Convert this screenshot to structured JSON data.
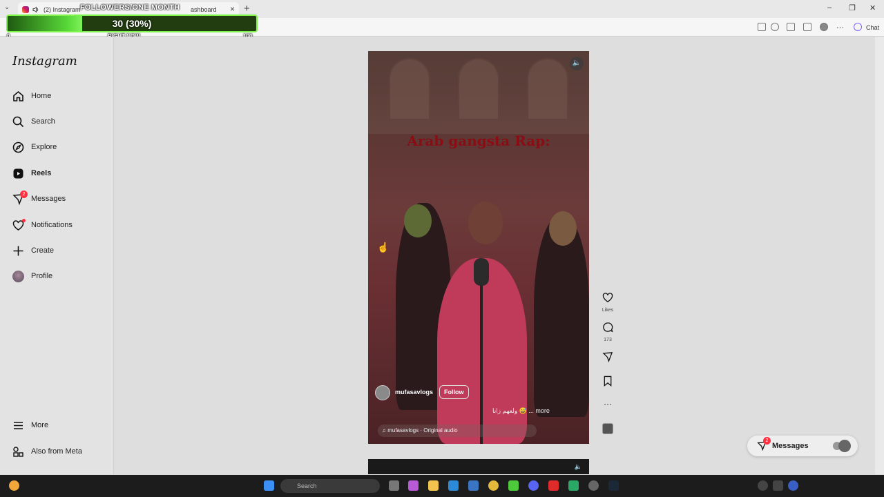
{
  "browser": {
    "tab_title": "(2) Instagram",
    "tab2_title": "ashboard",
    "chat_label": "Chat"
  },
  "overlay": {
    "title": "FOLLOWERS/ONE MONTH",
    "value_text": "30 (30%)",
    "progress": 0.3,
    "min": "0",
    "now_label": "RIGHT NOW",
    "max": "100"
  },
  "sidebar": {
    "logo": "Instagram",
    "items": [
      {
        "label": "Home",
        "icon": "home-icon"
      },
      {
        "label": "Search",
        "icon": "search-icon"
      },
      {
        "label": "Explore",
        "icon": "compass-icon"
      },
      {
        "label": "Reels",
        "icon": "reels-icon",
        "active": true
      },
      {
        "label": "Messages",
        "icon": "messenger-icon",
        "badge": "2"
      },
      {
        "label": "Notifications",
        "icon": "heart-icon",
        "dot": true
      },
      {
        "label": "Create",
        "icon": "plus-icon"
      },
      {
        "label": "Profile",
        "icon": "avatar"
      }
    ],
    "bottom_items": [
      {
        "label": "More",
        "icon": "menu-icon"
      },
      {
        "label": "Also from Meta",
        "icon": "meta-apps-icon"
      }
    ]
  },
  "reel": {
    "caption": "Arab gangsta Rap:",
    "author": "mufasavlogs",
    "follow_label": "Follow",
    "description": "ولعهم زانا 😅 ... more",
    "audio": "♫ mufasavlogs · Original audio"
  },
  "actions": {
    "likes_label": "Likes",
    "comments_count": "173"
  },
  "messages_pill": {
    "label": "Messages",
    "badge": "2"
  },
  "taskbar": {
    "search_placeholder": "Search"
  }
}
